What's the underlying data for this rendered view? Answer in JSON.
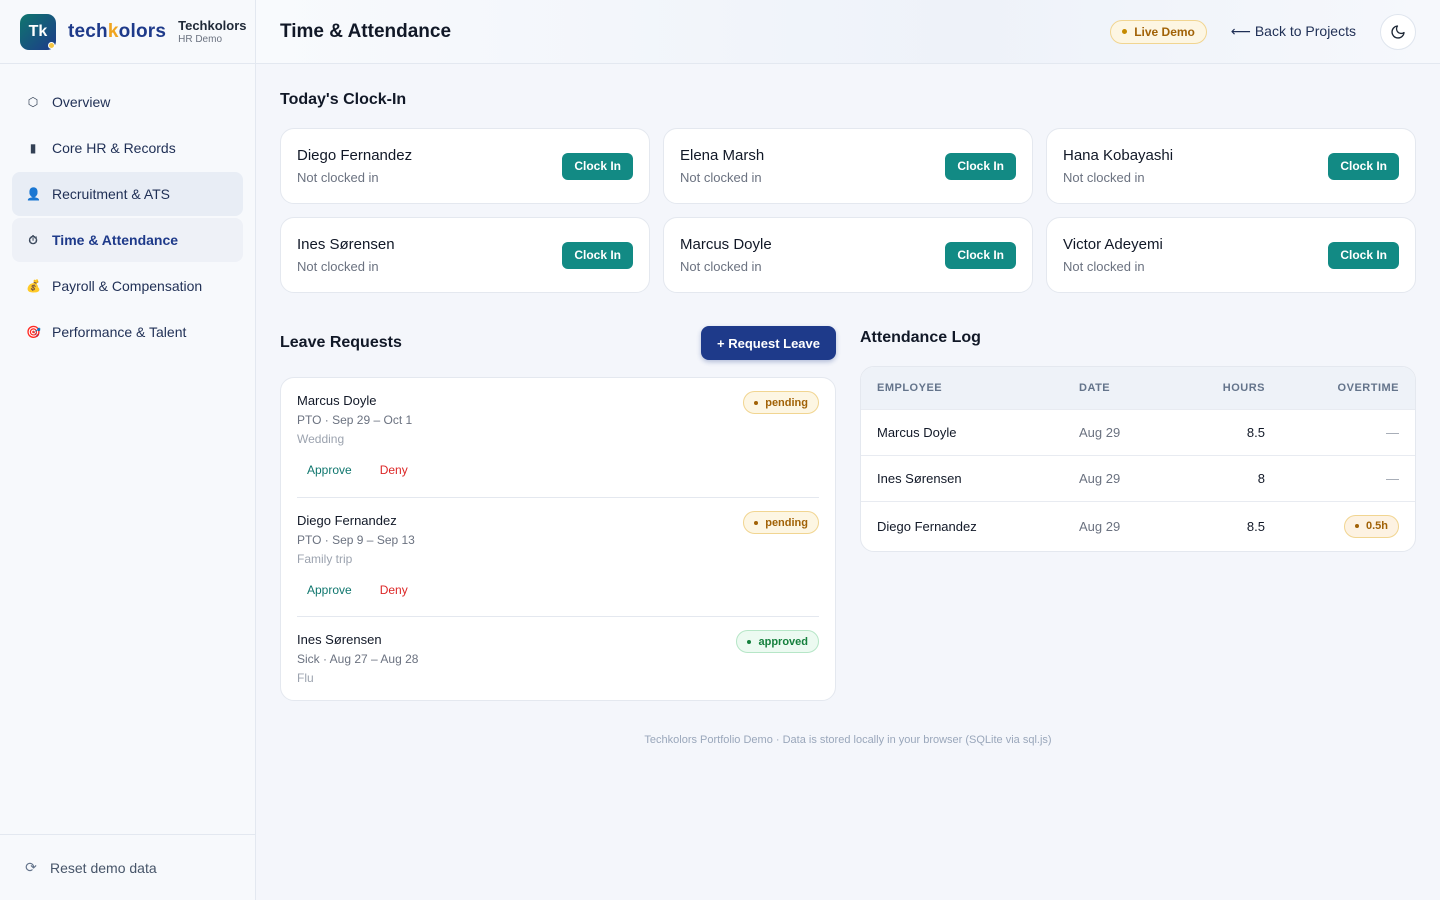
{
  "brand": {
    "badge": "Tk",
    "wordmark_a": "tech",
    "wordmark_k": "k",
    "wordmark_b": "olors",
    "name": "Techkolors",
    "sub": "HR Demo"
  },
  "sidebar": {
    "items": [
      {
        "label": "Overview",
        "icon": "⬡"
      },
      {
        "label": "Core HR & Records",
        "icon": "▮"
      },
      {
        "label": "Recruitment & ATS",
        "icon": "👤"
      },
      {
        "label": "Time & Attendance",
        "icon": "⏱"
      },
      {
        "label": "Payroll & Compensation",
        "icon": "💰"
      },
      {
        "label": "Performance & Talent",
        "icon": "🎯"
      }
    ],
    "reset_label": "Reset demo data",
    "reset_icon": "⟳"
  },
  "header": {
    "title": "Time & Attendance",
    "live_badge": "Live Demo",
    "back_link": "⟵ Back to Projects"
  },
  "clock_in": {
    "title": "Today's Clock-In",
    "button_label": "Clock In",
    "employees": [
      {
        "name": "Diego Fernandez",
        "status": "Not clocked in"
      },
      {
        "name": "Elena Marsh",
        "status": "Not clocked in"
      },
      {
        "name": "Hana Kobayashi",
        "status": "Not clocked in"
      },
      {
        "name": "Ines Sørensen",
        "status": "Not clocked in"
      },
      {
        "name": "Marcus Doyle",
        "status": "Not clocked in"
      },
      {
        "name": "Victor Adeyemi",
        "status": "Not clocked in"
      }
    ]
  },
  "leave": {
    "title": "Leave Requests",
    "request_button": "+ Request Leave",
    "approve_label": "Approve",
    "deny_label": "Deny",
    "requests": [
      {
        "name": "Marcus Doyle",
        "dates": "PTO · Sep 29 – Oct 1",
        "reason": "Wedding",
        "status": "pending"
      },
      {
        "name": "Diego Fernandez",
        "dates": "PTO · Sep 9 – Sep 13",
        "reason": "Family trip",
        "status": "pending"
      },
      {
        "name": "Ines Sørensen",
        "dates": "Sick · Aug 27 – Aug 28",
        "reason": "Flu",
        "status": "approved"
      }
    ]
  },
  "attendance": {
    "title": "Attendance Log",
    "columns": [
      "EMPLOYEE",
      "DATE",
      "HOURS",
      "OVERTIME"
    ],
    "rows": [
      {
        "employee": "Marcus Doyle",
        "date": "Aug 29",
        "hours": "8.5",
        "overtime": "—"
      },
      {
        "employee": "Ines Sørensen",
        "date": "Aug 29",
        "hours": "8",
        "overtime": "—"
      },
      {
        "employee": "Diego Fernandez",
        "date": "Aug 29",
        "hours": "8.5",
        "overtime": "0.5h"
      }
    ]
  },
  "footer": "Techkolors Portfolio Demo · Data is stored locally in your browser (SQLite via sql.js)",
  "colors": {
    "accent_teal": "#128a84",
    "primary_navy": "#1e3a8a",
    "pending": "#a16207",
    "approved": "#15803d",
    "deny": "#dc2626"
  }
}
